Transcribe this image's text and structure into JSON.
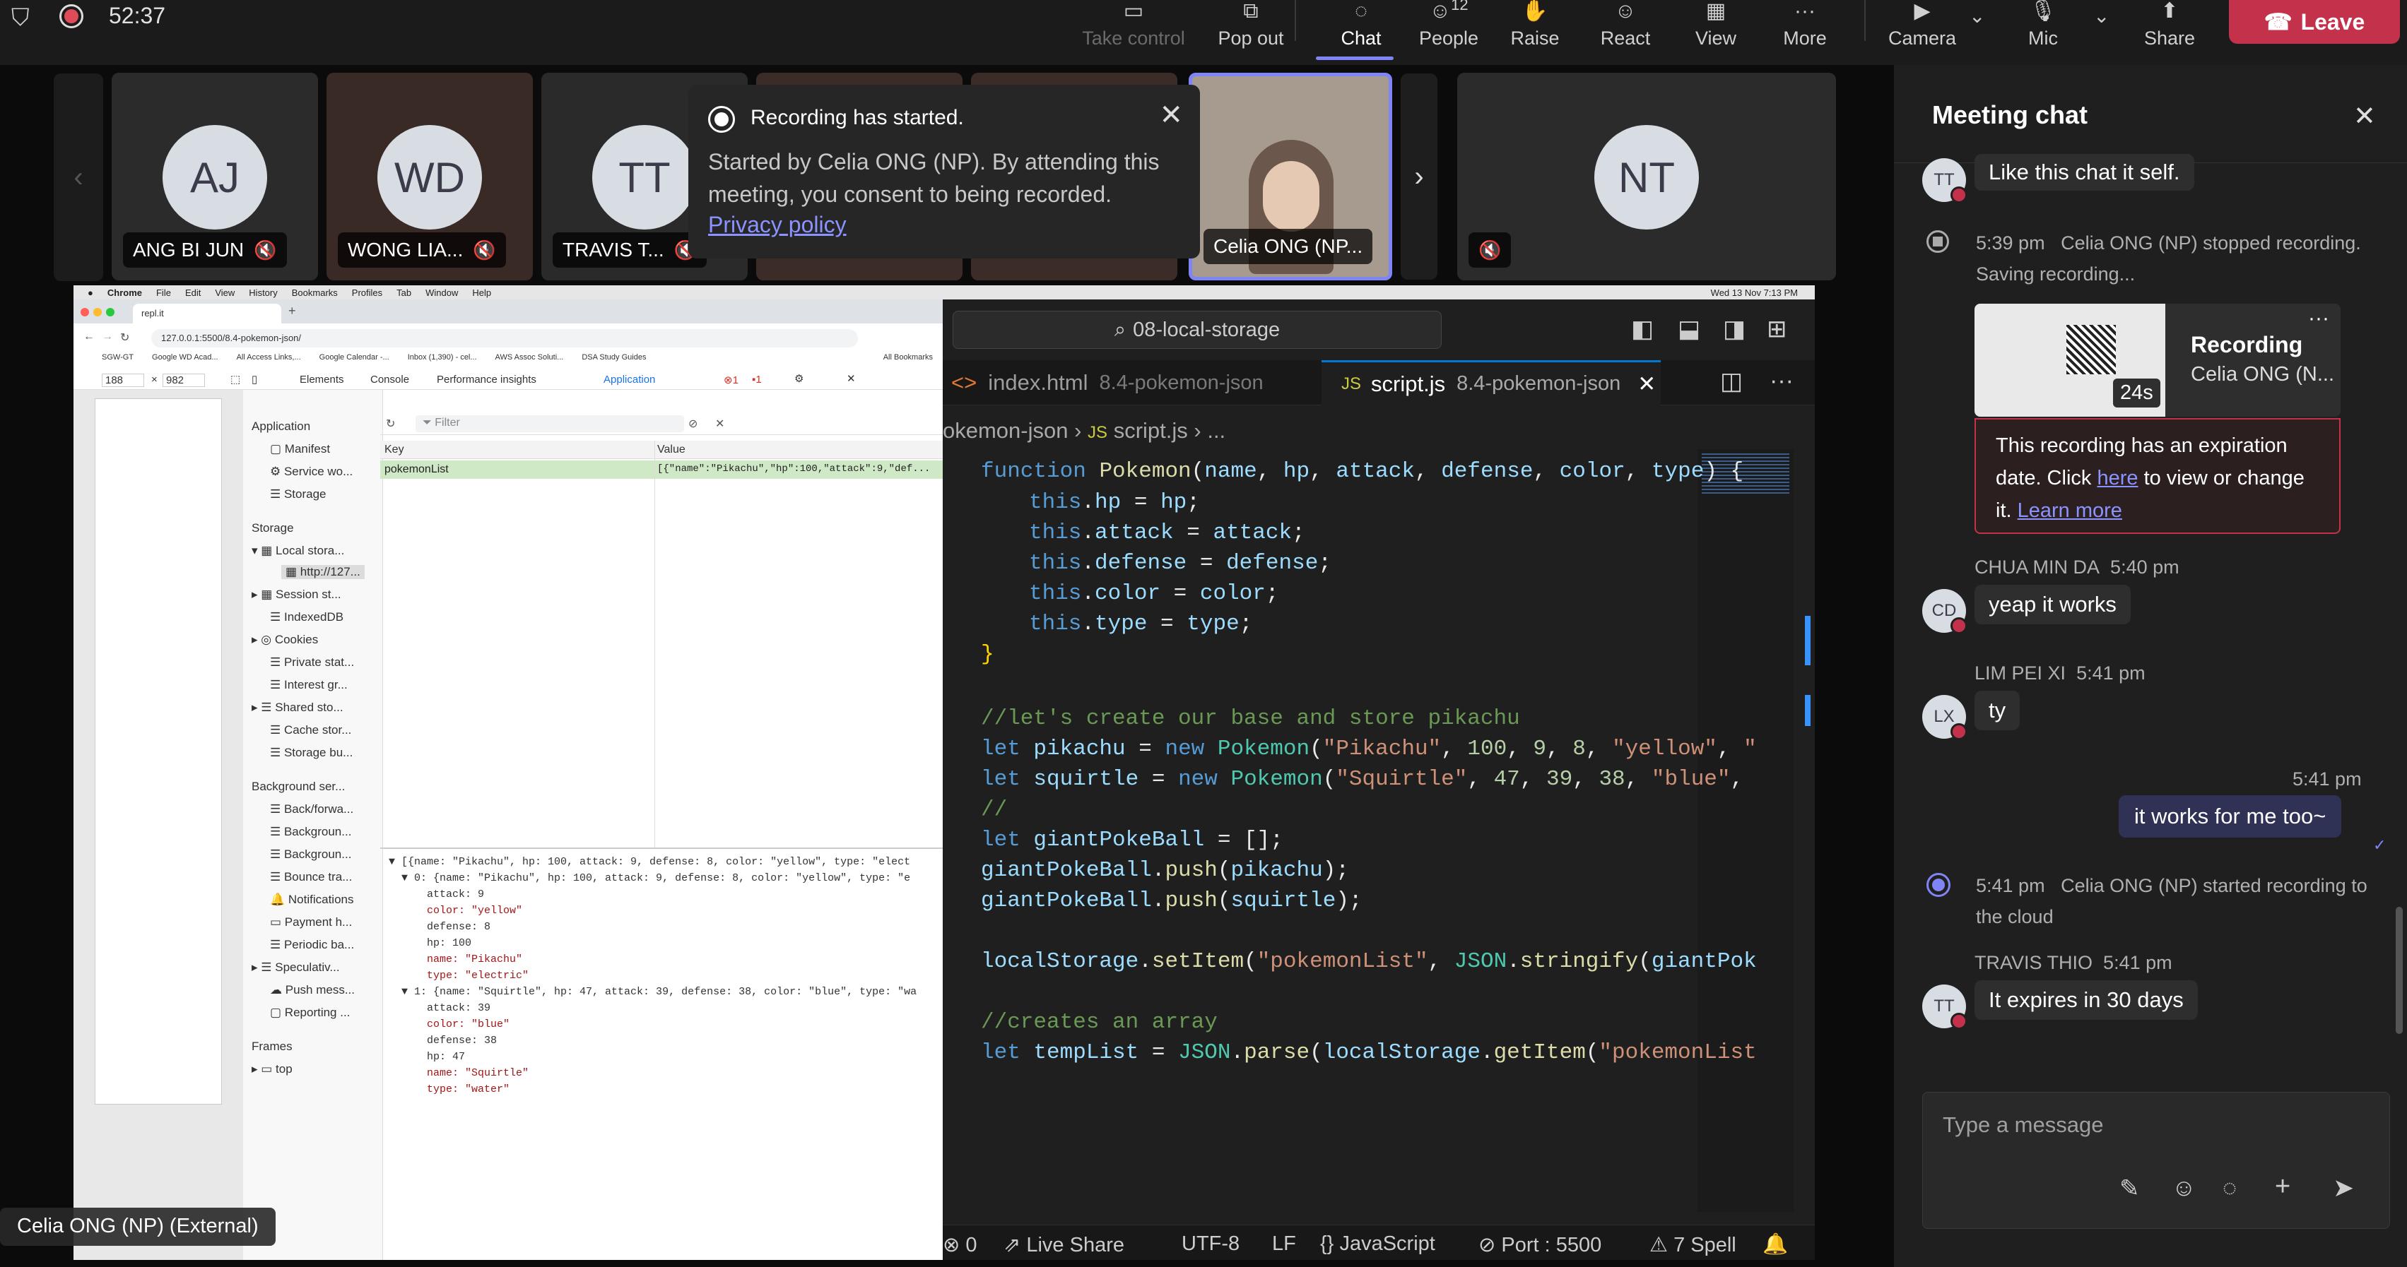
{
  "topbar": {
    "timer": "52:37",
    "buttons": [
      {
        "label": "Take control",
        "icon": "take-control-icon"
      },
      {
        "label": "Pop out",
        "icon": "pop-out-icon"
      },
      {
        "label": "Chat",
        "icon": "chat-icon"
      },
      {
        "label": "People",
        "icon": "people-icon",
        "count": "12"
      },
      {
        "label": "Raise",
        "icon": "raise-hand-icon"
      },
      {
        "label": "React",
        "icon": "react-icon"
      },
      {
        "label": "View",
        "icon": "view-icon"
      },
      {
        "label": "More",
        "icon": "more-icon"
      },
      {
        "label": "Camera",
        "icon": "camera-icon"
      },
      {
        "label": "Mic",
        "icon": "mic-icon"
      },
      {
        "label": "Share",
        "icon": "share-icon"
      }
    ],
    "leave_label": "Leave"
  },
  "participants": [
    {
      "initials": "AJ",
      "name": "ANG BI JUN"
    },
    {
      "initials": "WD",
      "name": "WONG LIA..."
    },
    {
      "initials": "TT",
      "name": "TRAVIS T..."
    },
    {
      "initials": "",
      "name": "Celia ONG (NP..."
    },
    {
      "initials": "NT",
      "name": ""
    }
  ],
  "recording_toast": {
    "title": "Recording has started.",
    "body": "Started by Celia ONG (NP). By attending this meeting, you consent to being recorded.",
    "link": "Privacy policy"
  },
  "presenter_label": "Celia ONG (NP) (External)",
  "chrome": {
    "menubar": [
      "Chrome",
      "File",
      "Edit",
      "View",
      "History",
      "Bookmarks",
      "Profiles",
      "Tab",
      "Window",
      "Help"
    ],
    "clock": "Wed 13 Nov 7:13 PM",
    "tab_title": "repl.it",
    "url": "127.0.0.1:5500/8.4-pokemon-json/",
    "bookmarks": [
      "SGW-GT",
      "Google WD Acad...",
      "All Access Links,...",
      "Google Calendar -...",
      "Inbox (1,390) - cel...",
      "AWS Assoc Soluti...",
      "DSA Study Guides",
      "All Bookmarks"
    ],
    "viewport_w": "188",
    "viewport_h": "982",
    "devtools_tabs": [
      "Elements",
      "Console",
      "Performance insights",
      "Application"
    ],
    "errors": "1",
    "warnings": "1",
    "app_header": "Application",
    "app_items": [
      "Manifest",
      "Service wo...",
      "Storage"
    ],
    "storage_header": "Storage",
    "storage_items": [
      "Local stora...",
      "http://127...",
      "Session st...",
      "IndexedDB",
      "Cookies",
      "Private stat...",
      "Interest gr...",
      "Shared sto...",
      "Cache stor...",
      "Storage bu..."
    ],
    "bg_header": "Background ser...",
    "bg_items": [
      "Back/forwa...",
      "Backgroun...",
      "Backgroun...",
      "Bounce tra...",
      "Notifications",
      "Payment h...",
      "Periodic ba...",
      "Speculativ...",
      "Push mess...",
      "Reporting ..."
    ],
    "frames_header": "Frames",
    "frames_items": [
      "top"
    ],
    "filter_placeholder": "Filter",
    "table_key": "Key",
    "table_value": "Value",
    "row_key": "pokemonList",
    "row_value": "[{\"name\":\"Pikachu\",\"hp\":100,\"attack\":9,\"def...",
    "console_lines": [
      "▼ [{name: \"Pikachu\", hp: 100, attack: 9, defense: 8, color: \"yellow\", type: \"elect",
      "  ▼ 0: {name: \"Pikachu\", hp: 100, attack: 9, defense: 8, color: \"yellow\", type: \"e",
      "      attack: 9",
      "      color: \"yellow\"",
      "      defense: 8",
      "      hp: 100",
      "      name: \"Pikachu\"",
      "      type: \"electric\"",
      "  ▼ 1: {name: \"Squirtle\", hp: 47, attack: 39, defense: 38, color: \"blue\", type: \"wa",
      "      attack: 39",
      "      color: \"blue\"",
      "      defense: 38",
      "      hp: 47",
      "      name: \"Squirtle\"",
      "      type: \"water\""
    ]
  },
  "vscode": {
    "search": "08-local-storage",
    "tabs": [
      {
        "file": "index.html",
        "folder": "8.4-pokemon-json"
      },
      {
        "file": "script.js",
        "folder": "8.4-pokemon-json"
      }
    ],
    "breadcrumb_folder": "okemon-json",
    "breadcrumb_file": "script.js",
    "breadcrumb_tail": "...",
    "status": {
      "problems": "0",
      "live_share": "Live Share",
      "encoding": "UTF-8",
      "eol": "LF",
      "lang": "JavaScript",
      "port": "Port : 5500",
      "spell": "7 Spell"
    }
  },
  "chat": {
    "title": "Meeting chat",
    "messages": [
      {
        "avatar": "TT",
        "text": "Like this chat it self."
      },
      {
        "time": "5:39 pm",
        "system": "Celia ONG (NP) stopped recording. Saving recording..."
      },
      {
        "card_title": "Recording",
        "card_sub": "Celia ONG (N...",
        "duration": "24s"
      },
      {
        "warning": "This recording has an expiration date. Click",
        "warning_link": "here",
        "warning_rest": "to view or change it.",
        "learn_more": "Learn more"
      },
      {
        "sender": "CHUA MIN DA",
        "time": "5:40 pm",
        "avatar": "CD",
        "text": "yeap it works"
      },
      {
        "sender": "LIM PEI XI",
        "time": "5:41 pm",
        "avatar": "LX",
        "text": "ty"
      },
      {
        "time": "5:41 pm",
        "text": "it works for me too~"
      },
      {
        "time": "5:41 pm",
        "system": "Celia ONG (NP) started recording to the cloud"
      },
      {
        "sender": "TRAVIS THIO",
        "time": "5:41 pm",
        "avatar": "TT",
        "text": "It expires in 30 days"
      }
    ],
    "input_placeholder": "Type a message"
  }
}
